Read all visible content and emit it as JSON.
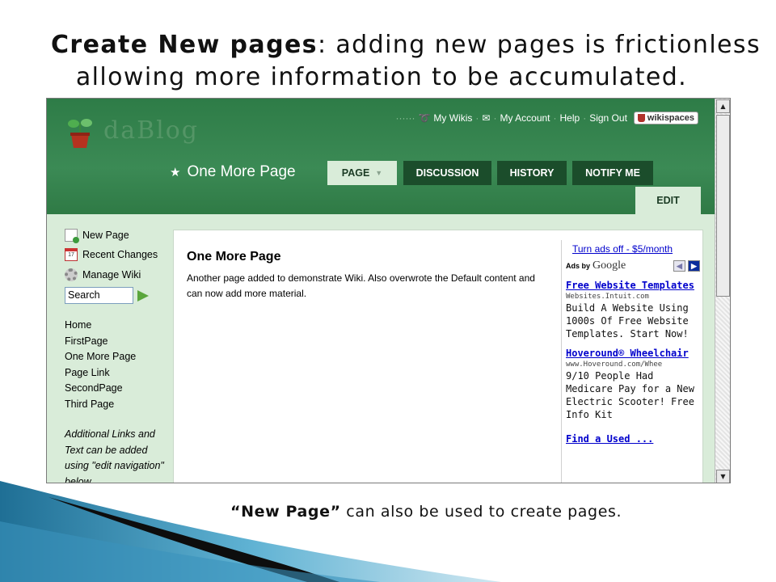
{
  "slide": {
    "title_bold": "Create New pages",
    "title_rest": ": adding new pages is frictionless",
    "title_line2": "allowing more information to be accumulated.",
    "caption_bold": "“New Page”",
    "caption_rest": " can also be used to create pages."
  },
  "header": {
    "logo_text": "daBlog",
    "top_links": {
      "user": "······",
      "my_wikis": "My Wikis",
      "my_account": "My Account",
      "help": "Help",
      "sign_out": "Sign Out",
      "badge": "wikispaces"
    },
    "page_title": "One More Page",
    "tabs": {
      "page": "PAGE",
      "discussion": "DISCUSSION",
      "history": "HISTORY",
      "notify": "NOTIFY ME",
      "edit": "EDIT"
    }
  },
  "sidebar": {
    "actions": {
      "new_page": "New Page",
      "recent_changes": "Recent Changes",
      "manage_wiki": "Manage Wiki"
    },
    "search_value": "Search",
    "links": [
      "Home",
      "FirstPage",
      "One More Page",
      "Page Link",
      "SecondPage",
      "Third Page"
    ],
    "note": "Additional Links and Text can be added using \"edit navigation\" below"
  },
  "content": {
    "title": "One More Page",
    "body": "Another page added to demonstrate Wiki. Also overwrote the Default content and can now add more material."
  },
  "ads": {
    "turn_off": "Turn ads off - $5/month",
    "ads_by": "Ads by",
    "google": "Google",
    "items": [
      {
        "title": "Free Website Templates",
        "url": "Websites.Intuit.com",
        "text": "Build A Website Using 1000s Of Free Website Templates. Start Now!"
      },
      {
        "title": "Hoveround® Wheelchair",
        "url": "www.Hoveround.com/Whee",
        "text": "9/10 People Had Medicare Pay for a New Electric Scooter! Free Info Kit"
      }
    ],
    "cut_off_title": "Find a Used ..."
  },
  "colors": {
    "header_green": "#2e7c47",
    "tab_dark": "#1b4d2b",
    "sidebar_bg": "#d9ecd9",
    "link_blue": "#0000cc"
  }
}
